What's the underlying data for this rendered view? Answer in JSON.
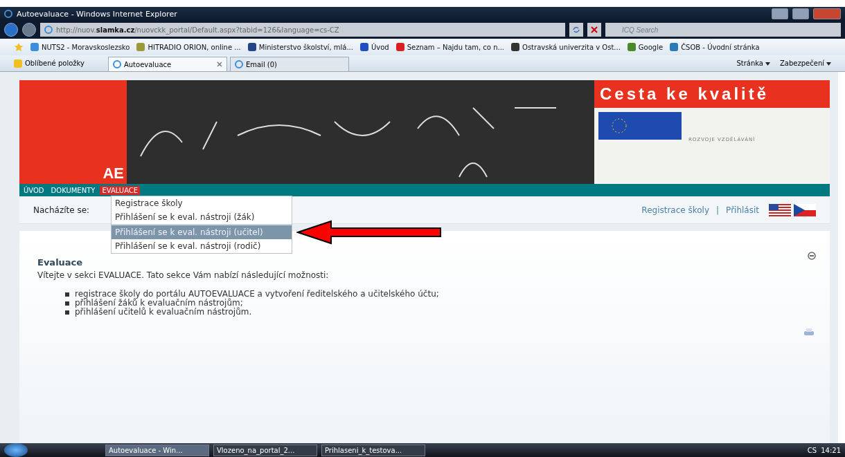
{
  "window": {
    "title": "Autoevaluace - Windows Internet Explorer"
  },
  "address": {
    "url": "http://nuov.**slamka.cz**/nuovckk_portal/Default.aspx?tabid=126&language=cs-CZ"
  },
  "search": {
    "placeholder": "ICQ Search"
  },
  "favorites_bar": [
    {
      "label": "NUTS2 - Moravskoslezsko"
    },
    {
      "label": "HITRADIO ORION, online ..."
    },
    {
      "label": "Ministerstvo školství, mlá..."
    },
    {
      "label": "Úvod"
    },
    {
      "label": "Seznam – Najdu tam, co n..."
    },
    {
      "label": "Ostravská univerzita v Ost..."
    },
    {
      "label": "Google"
    },
    {
      "label": "ČSOB - Úvodní stránka"
    }
  ],
  "favorites_label": "Oblíbené položky",
  "tabs": [
    {
      "label": "Autoevaluace",
      "selected": true
    },
    {
      "label": "Email (0)",
      "selected": false
    }
  ],
  "command_bar": [
    "Stránka",
    "Zabezpečení"
  ],
  "banner": {
    "title": "Cesta ke kvalitě",
    "logo_text": "AE",
    "partner_text": "ROZVOJE VZDĚLÁVÁNÍ"
  },
  "nav": [
    {
      "label": "ÚVOD",
      "selected": false
    },
    {
      "label": "DOKUMENTY",
      "selected": false
    },
    {
      "label": "EVALUACE",
      "selected": true
    }
  ],
  "dropdown": [
    {
      "label": "Registrace školy",
      "selected": false
    },
    {
      "label": "Přihlášení se k eval. nástroji (žák)",
      "selected": false
    },
    {
      "label": "Přihlášení se k eval. nástroji (učitel)",
      "selected": true
    },
    {
      "label": "Přihlášení se k eval. nástroji (rodič)",
      "selected": false
    }
  ],
  "breadcrumb": {
    "label": "Nacházíte se:"
  },
  "top_links": {
    "items": [
      "Registrace školy",
      "Přihlásit"
    ],
    "separator": "|"
  },
  "content": {
    "heading": "Evaluace",
    "intro": "Vítejte v sekci EVALUACE. Tato sekce Vám nabízí následující možnosti:",
    "bullets": [
      "registrace školy do portálu AUTOEVALUACE a vytvoření ředitelského a učitelského účtu;",
      "přihlášení žáků k evaluačním nástrojům;",
      "přihlášení učitelů k evaluačním nástrojům."
    ]
  },
  "taskbar": {
    "tasks": [
      {
        "label": "Autoevaluace - Win...",
        "selected": true
      },
      {
        "label": "Vlozeno_na_portal_2...",
        "selected": false
      },
      {
        "label": "Prihlaseni_k_testova...",
        "selected": false
      }
    ],
    "language": "CS",
    "clock": "14:21"
  }
}
